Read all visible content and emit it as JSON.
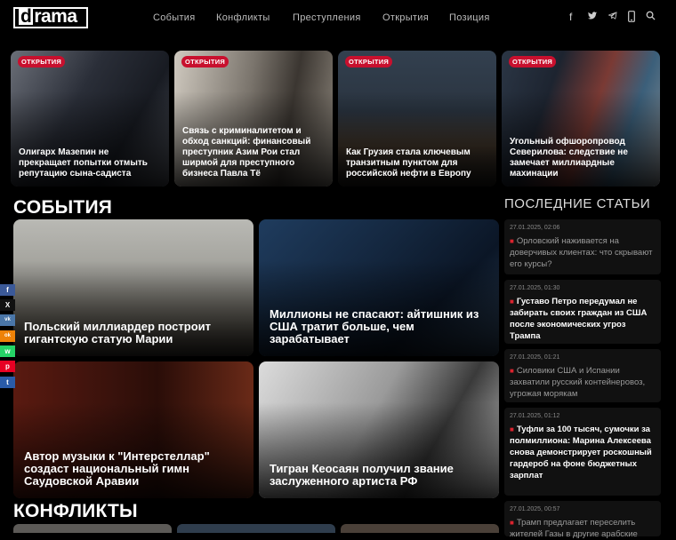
{
  "logo": "drama",
  "nav": [
    "События",
    "Конфликты",
    "Преступления",
    "Открытия",
    "Позиция"
  ],
  "social_icons": [
    "facebook-icon",
    "twitter-icon",
    "telegram-icon",
    "phone-icon",
    "search-icon"
  ],
  "hero": [
    {
      "badge": "ОТКРЫТИЯ",
      "title": "Олигарх Мазепин не прекращает попытки отмыть репутацию сына-садиста"
    },
    {
      "badge": "ОТКРЫТИЯ",
      "title": "Связь с криминалитетом и обход санкций: финансовый преступник Азим Рои стал ширмой для преступного бизнеса Павла Тё"
    },
    {
      "badge": "ОТКРЫТИЯ",
      "title": "Как Грузия стала ключевым транзитным пунктом для российской нефти в Европу"
    },
    {
      "badge": "ОТКРЫТИЯ",
      "title": "Угольный офшоропровод Северилова: следствие не замечает миллиардные махинации"
    }
  ],
  "sections": {
    "events": "СОБЫТИЯ",
    "conflicts": "КОНФЛИКТЫ"
  },
  "events_cards": [
    {
      "title": "Польский миллиардер построит гигантскую статую Марии"
    },
    {
      "title": "Миллионы не спасают: айтишник из США тратит больше, чем зарабатывает"
    },
    {
      "title": "Автор музыки к \"Интерстеллар\" создаст национальный гимн Саудовской Аравии"
    },
    {
      "title": "Тигран Кеосаян получил звание заслуженного артиста РФ"
    }
  ],
  "latest": {
    "heading": "ПОСЛЕДНИЕ СТАТЬИ",
    "items": [
      {
        "date": "27.01.2025, 02:06",
        "text": "Орловский наживается на доверчивых клиентах: что скрывают его курсы?"
      },
      {
        "date": "27.01.2025, 01:30",
        "text": "Густаво Петро передумал не забирать своих граждан из США после экономических угроз Трампа"
      },
      {
        "date": "27.01.2025, 01:21",
        "text": "Силовики США и Испании захватили русский контейнеровоз, угрожая морякам"
      },
      {
        "date": "27.01.2025, 01:12",
        "text": "Туфли за 100 тысяч, сумочки за полмиллиона: Марина Алексеева снова демонстрирует роскошный гардероб на фоне бюджетных зарплат"
      },
      {
        "date": "27.01.2025, 00:57",
        "text": "Трамп предлагает переселить жителей Газы в другие арабские"
      }
    ]
  },
  "share": [
    "f",
    "X",
    "vk",
    "ok",
    "w",
    "p",
    "t"
  ],
  "colors": {
    "accent": "#c8102e",
    "background": "#000000",
    "panel": "#111111"
  }
}
